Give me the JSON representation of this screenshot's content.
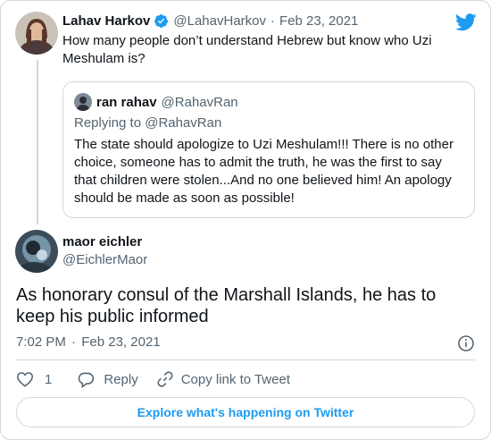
{
  "parent_tweet": {
    "display_name": "Lahav Harkov",
    "handle": "@LahavHarkov",
    "separator": "·",
    "date": "Feb 23, 2021",
    "text_line1": "How many people don’t understand Hebrew but know who Uzi",
    "text_line2": "Meshulam is?"
  },
  "quoted_tweet": {
    "display_name": "ran rahav",
    "handle": "@RahavRan",
    "replying_to_label": "Replying to",
    "replying_to_handle": "@RahavRan",
    "text_lines": [
      "The state should apologize to Uzi Meshulam!!! There is no other",
      "choice, someone has to admit the truth, he was the first to say",
      "that children were stolen...And no one believed him! An apology",
      "should be made as soon as possible!"
    ]
  },
  "main_tweet": {
    "display_name": "maor eichler",
    "handle": "@EichlerMaor",
    "text_line1": "As honorary consul of the Marshall Islands, he has to",
    "text_line2": "keep his public informed",
    "time": "7:02 PM",
    "separator": "·",
    "date": "Feb 23, 2021"
  },
  "actions": {
    "like_count": "1",
    "reply_label": "Reply",
    "copy_link_label": "Copy link to Tweet"
  },
  "explore_label": "Explore what's happening on Twitter",
  "colors": {
    "accent": "#1d9bf0",
    "text": "#0f1419",
    "muted": "#536471",
    "border": "#cfd9de"
  },
  "icons": [
    "twitter-bird-icon",
    "verified-badge-icon",
    "info-icon",
    "heart-icon",
    "reply-icon",
    "link-icon"
  ]
}
